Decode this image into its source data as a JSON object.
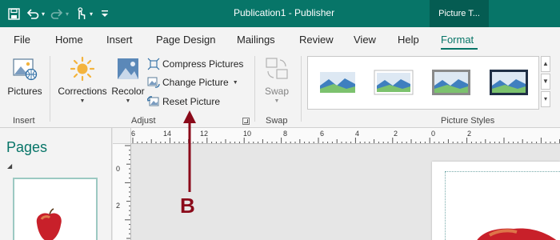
{
  "window": {
    "title": "Publication1  -  Publisher",
    "contextual_tab": "Picture T..."
  },
  "tabs": [
    "File",
    "Home",
    "Insert",
    "Page Design",
    "Mailings",
    "Review",
    "View",
    "Help",
    "Format"
  ],
  "active_tab": "Format",
  "ribbon": {
    "insert_group": {
      "pictures_label": "Pictures",
      "group_label": "Insert"
    },
    "adjust_group": {
      "corrections_label": "Corrections",
      "recolor_label": "Recolor",
      "compress_label": "Compress Pictures",
      "change_label": "Change Picture",
      "reset_label": "Reset Picture",
      "group_label": "Adjust"
    },
    "swap_group": {
      "swap_label": "Swap",
      "group_label": "Swap"
    },
    "styles_group": {
      "group_label": "Picture Styles"
    }
  },
  "pages_pane": {
    "title": "Pages"
  },
  "ruler": {
    "horizontal_labels": [
      "6",
      "14",
      "12",
      "10",
      "8",
      "6",
      "4",
      "2",
      "0",
      "2"
    ],
    "vertical_labels": [
      "0",
      "2"
    ]
  },
  "annotation": {
    "label": "B",
    "color": "#8b0a1a"
  },
  "colors": {
    "accent": "#077568",
    "ribbon_bg": "#f3f3f3"
  }
}
